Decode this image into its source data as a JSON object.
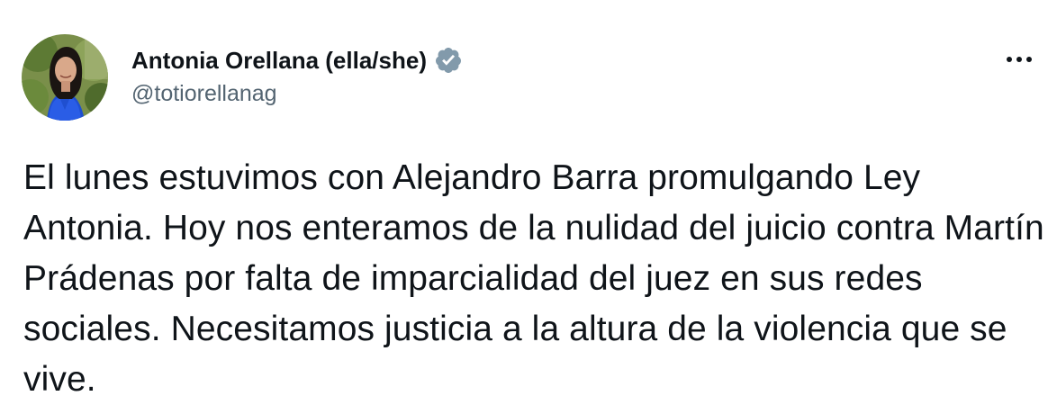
{
  "author": {
    "display_name": "Antonia Orellana (ella/she)",
    "handle": "@totiorellanag",
    "verified": true,
    "avatar_icon": "profile-photo"
  },
  "tweet": {
    "text": "El lunes estuvimos con Alejandro Barra promulgando Ley Antonia. Hoy nos enteramos de la nulidad del juicio contra Martín Prádenas por falta de imparcialidad del juez en sus redes sociales. Necesitamos justicia a la altura de la violencia que se vive."
  },
  "menu": {
    "icon": "more-horizontal-icon"
  },
  "colors": {
    "text_primary": "#0f1419",
    "text_secondary": "#536471",
    "verified_badge": "#829aab"
  }
}
